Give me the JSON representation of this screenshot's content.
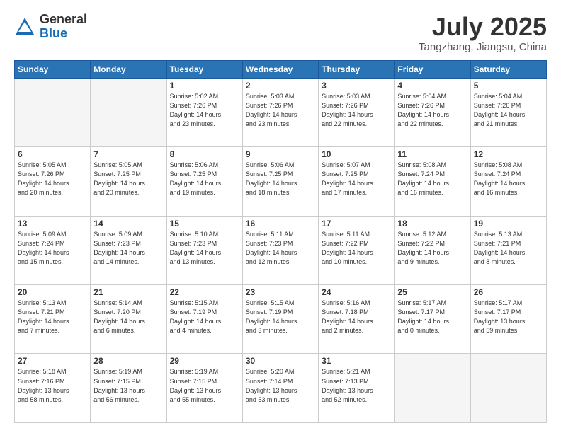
{
  "logo": {
    "general": "General",
    "blue": "Blue"
  },
  "title": "July 2025",
  "subtitle": "Tangzhang, Jiangsu, China",
  "weekdays": [
    "Sunday",
    "Monday",
    "Tuesday",
    "Wednesday",
    "Thursday",
    "Friday",
    "Saturday"
  ],
  "weeks": [
    [
      {
        "day": "",
        "info": ""
      },
      {
        "day": "",
        "info": ""
      },
      {
        "day": "1",
        "info": "Sunrise: 5:02 AM\nSunset: 7:26 PM\nDaylight: 14 hours\nand 23 minutes."
      },
      {
        "day": "2",
        "info": "Sunrise: 5:03 AM\nSunset: 7:26 PM\nDaylight: 14 hours\nand 23 minutes."
      },
      {
        "day": "3",
        "info": "Sunrise: 5:03 AM\nSunset: 7:26 PM\nDaylight: 14 hours\nand 22 minutes."
      },
      {
        "day": "4",
        "info": "Sunrise: 5:04 AM\nSunset: 7:26 PM\nDaylight: 14 hours\nand 22 minutes."
      },
      {
        "day": "5",
        "info": "Sunrise: 5:04 AM\nSunset: 7:26 PM\nDaylight: 14 hours\nand 21 minutes."
      }
    ],
    [
      {
        "day": "6",
        "info": "Sunrise: 5:05 AM\nSunset: 7:26 PM\nDaylight: 14 hours\nand 20 minutes."
      },
      {
        "day": "7",
        "info": "Sunrise: 5:05 AM\nSunset: 7:25 PM\nDaylight: 14 hours\nand 20 minutes."
      },
      {
        "day": "8",
        "info": "Sunrise: 5:06 AM\nSunset: 7:25 PM\nDaylight: 14 hours\nand 19 minutes."
      },
      {
        "day": "9",
        "info": "Sunrise: 5:06 AM\nSunset: 7:25 PM\nDaylight: 14 hours\nand 18 minutes."
      },
      {
        "day": "10",
        "info": "Sunrise: 5:07 AM\nSunset: 7:25 PM\nDaylight: 14 hours\nand 17 minutes."
      },
      {
        "day": "11",
        "info": "Sunrise: 5:08 AM\nSunset: 7:24 PM\nDaylight: 14 hours\nand 16 minutes."
      },
      {
        "day": "12",
        "info": "Sunrise: 5:08 AM\nSunset: 7:24 PM\nDaylight: 14 hours\nand 16 minutes."
      }
    ],
    [
      {
        "day": "13",
        "info": "Sunrise: 5:09 AM\nSunset: 7:24 PM\nDaylight: 14 hours\nand 15 minutes."
      },
      {
        "day": "14",
        "info": "Sunrise: 5:09 AM\nSunset: 7:23 PM\nDaylight: 14 hours\nand 14 minutes."
      },
      {
        "day": "15",
        "info": "Sunrise: 5:10 AM\nSunset: 7:23 PM\nDaylight: 14 hours\nand 13 minutes."
      },
      {
        "day": "16",
        "info": "Sunrise: 5:11 AM\nSunset: 7:23 PM\nDaylight: 14 hours\nand 12 minutes."
      },
      {
        "day": "17",
        "info": "Sunrise: 5:11 AM\nSunset: 7:22 PM\nDaylight: 14 hours\nand 10 minutes."
      },
      {
        "day": "18",
        "info": "Sunrise: 5:12 AM\nSunset: 7:22 PM\nDaylight: 14 hours\nand 9 minutes."
      },
      {
        "day": "19",
        "info": "Sunrise: 5:13 AM\nSunset: 7:21 PM\nDaylight: 14 hours\nand 8 minutes."
      }
    ],
    [
      {
        "day": "20",
        "info": "Sunrise: 5:13 AM\nSunset: 7:21 PM\nDaylight: 14 hours\nand 7 minutes."
      },
      {
        "day": "21",
        "info": "Sunrise: 5:14 AM\nSunset: 7:20 PM\nDaylight: 14 hours\nand 6 minutes."
      },
      {
        "day": "22",
        "info": "Sunrise: 5:15 AM\nSunset: 7:19 PM\nDaylight: 14 hours\nand 4 minutes."
      },
      {
        "day": "23",
        "info": "Sunrise: 5:15 AM\nSunset: 7:19 PM\nDaylight: 14 hours\nand 3 minutes."
      },
      {
        "day": "24",
        "info": "Sunrise: 5:16 AM\nSunset: 7:18 PM\nDaylight: 14 hours\nand 2 minutes."
      },
      {
        "day": "25",
        "info": "Sunrise: 5:17 AM\nSunset: 7:17 PM\nDaylight: 14 hours\nand 0 minutes."
      },
      {
        "day": "26",
        "info": "Sunrise: 5:17 AM\nSunset: 7:17 PM\nDaylight: 13 hours\nand 59 minutes."
      }
    ],
    [
      {
        "day": "27",
        "info": "Sunrise: 5:18 AM\nSunset: 7:16 PM\nDaylight: 13 hours\nand 58 minutes."
      },
      {
        "day": "28",
        "info": "Sunrise: 5:19 AM\nSunset: 7:15 PM\nDaylight: 13 hours\nand 56 minutes."
      },
      {
        "day": "29",
        "info": "Sunrise: 5:19 AM\nSunset: 7:15 PM\nDaylight: 13 hours\nand 55 minutes."
      },
      {
        "day": "30",
        "info": "Sunrise: 5:20 AM\nSunset: 7:14 PM\nDaylight: 13 hours\nand 53 minutes."
      },
      {
        "day": "31",
        "info": "Sunrise: 5:21 AM\nSunset: 7:13 PM\nDaylight: 13 hours\nand 52 minutes."
      },
      {
        "day": "",
        "info": ""
      },
      {
        "day": "",
        "info": ""
      }
    ]
  ]
}
